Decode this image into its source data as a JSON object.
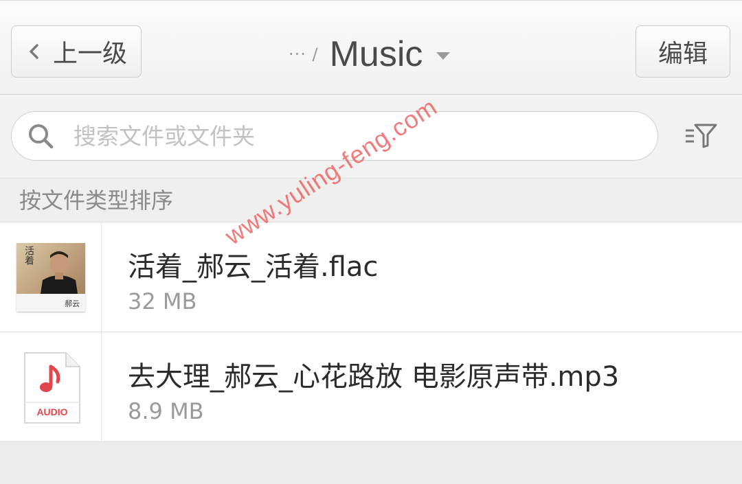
{
  "header": {
    "back_label": "上一级",
    "breadcrumb_ellipsis": "··· /",
    "title": "Music",
    "edit_label": "编辑"
  },
  "search": {
    "placeholder": "搜索文件或文件夹"
  },
  "sort": {
    "label": "按文件类型排序"
  },
  "files": [
    {
      "name": "活着_郝云_活着.flac",
      "size": "32 MB",
      "thumbnail": "album-cover",
      "cover_text": "活着",
      "cover_sig": "郝云"
    },
    {
      "name": "去大理_郝云_心花路放 电影原声带.mp3",
      "size": "8.9 MB",
      "thumbnail": "audio-file-icon",
      "icon_label": "AUDIO"
    }
  ],
  "watermark": "www.yuling-feng.com",
  "colors": {
    "audio_red": "#e0474c",
    "watermark": "#ec5050"
  }
}
